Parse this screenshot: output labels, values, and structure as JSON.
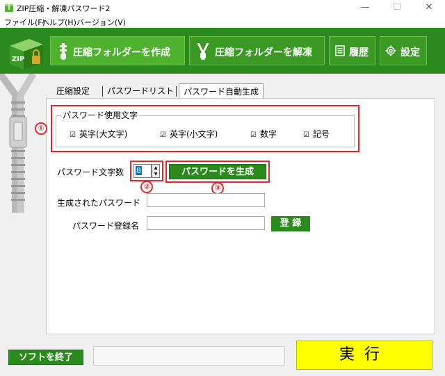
{
  "window": {
    "title": "ZIP圧縮・解凍パスワード2",
    "minimize_glyph": "—",
    "maximize_glyph": "☐",
    "close_glyph": "✕"
  },
  "menu": [
    "ファイル(F)",
    "ヘルプ(H)",
    "バージョン(V)"
  ],
  "toolbar": {
    "create_label": "圧縮フォルダーを作成",
    "extract_label": "圧縮フォルダーを解凍",
    "history_label": "履歴",
    "settings_label": "設定",
    "logo_text": "ZIP"
  },
  "tabs": [
    {
      "label": "圧縮設定",
      "active": false
    },
    {
      "label": "パスワードリスト",
      "active": false
    },
    {
      "label": "パスワード自動生成",
      "active": true
    }
  ],
  "char_group": {
    "legend": "パスワード使用文字",
    "options": [
      {
        "label": "英字(大文字)",
        "checked": true
      },
      {
        "label": "英字(小文字)",
        "checked": true
      },
      {
        "label": "数字",
        "checked": true
      },
      {
        "label": "記号",
        "checked": true
      }
    ]
  },
  "check_glyph": "☑",
  "length": {
    "label": "パスワード文字数",
    "value": "8"
  },
  "generate_button": "パスワードを生成",
  "generated": {
    "label": "生成されたパスワード",
    "value": ""
  },
  "register": {
    "label": "パスワード登録名",
    "value": "",
    "button": "登 録"
  },
  "annotations": [
    "①",
    "②",
    "③"
  ],
  "quit_button": "ソフトを終了",
  "run_button": "実行",
  "colors": {
    "brand_green": "#2b8a1e",
    "run_yellow": "#ffff00",
    "annotation_red": "#e5252a"
  }
}
